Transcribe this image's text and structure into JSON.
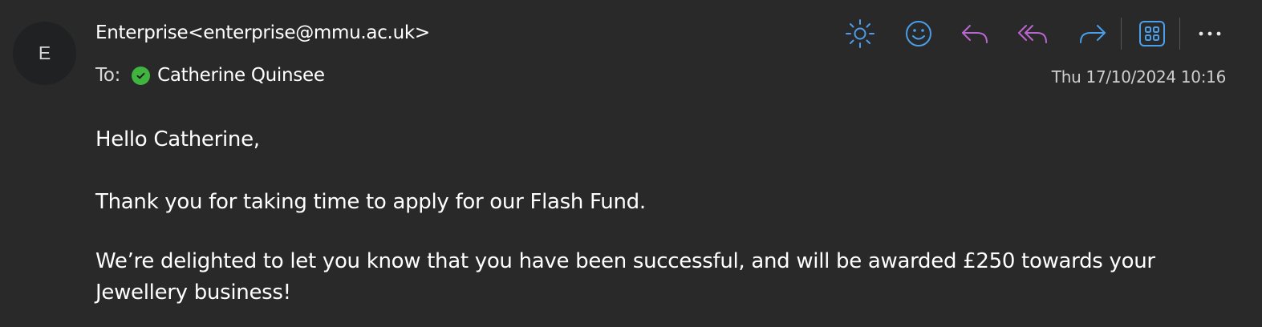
{
  "avatar": {
    "initial": "E"
  },
  "header": {
    "sender": "Enterprise<enterprise@mmu.ac.uk>",
    "to_label": "To:",
    "recipient": "Catherine Quinsee",
    "timestamp": "Thu 17/10/2024 10:16"
  },
  "toolbar": {
    "icons": [
      "sun-icon",
      "smiley-icon",
      "reply-icon",
      "reply-all-icon",
      "forward-icon",
      "apps-icon",
      "more-icon"
    ],
    "colors": {
      "blue": "#4a9eea",
      "purple": "#b967d0"
    }
  },
  "message": {
    "greeting": "Hello Catherine,",
    "line1": "Thank you for taking time to apply for our Flash Fund.",
    "line2": "We’re delighted to let you know that you have been successful, and will be awarded £250 towards your Jewellery business!"
  }
}
